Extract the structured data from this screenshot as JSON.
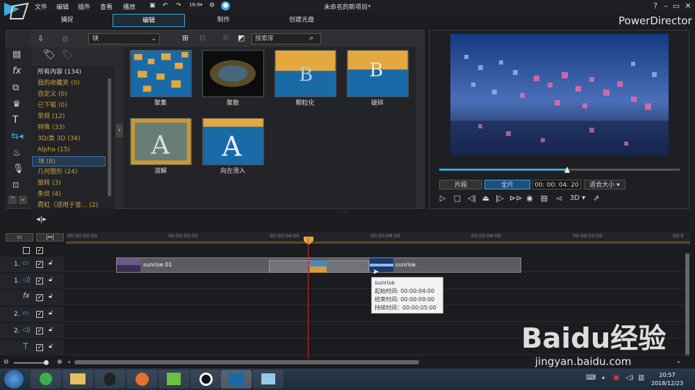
{
  "app": {
    "title": "未命名的新项目*",
    "brand": "PowerDirector"
  },
  "menu": [
    "文件",
    "编辑",
    "插件",
    "查看",
    "播放"
  ],
  "tabs": [
    "捕捉",
    "编辑",
    "制作",
    "创建光盘"
  ],
  "library": {
    "dropdown": "块",
    "search_placeholder": "搜索库",
    "categories": [
      "所有内容 (134)",
      "我的收藏夹 (0)",
      "自定义 (0)",
      "已下载 (0)",
      "常规 (12)",
      "特殊 (33)",
      "3D/类 3D (34)",
      "Alpha (15)",
      "块 (6)",
      "几何图形 (24)",
      "旋转 (3)",
      "条纹 (4)",
      "霓虹（适用于音... (2)"
    ],
    "thumbs": [
      "聚集",
      "聚散",
      "颗粒化",
      "破碎",
      "溶解",
      "向左滑入"
    ]
  },
  "preview": {
    "clip": "片段",
    "movie": "全片",
    "timecode": "00: 00: 04: 20",
    "fit": "适合大小",
    "mode3d": "3D",
    "progress": 0.53
  },
  "timeline": {
    "ticks": [
      "00:00:00:00",
      "00:00:02:00",
      "00:00:04:00",
      "00:00:06:00",
      "00:00:08:00",
      "00:00:10:00",
      "00:0"
    ],
    "tracks": [
      "1.",
      "1.",
      "",
      "2.",
      "2.",
      ""
    ],
    "clip1": "sunrise 01",
    "clip2": "sunrise",
    "tooltip": {
      "name": "sunrise",
      "start": "起始时间: 00:00:04:00",
      "end": "结束时间: 00:00:09:00",
      "dur": "持续时间：00:00:05:00"
    }
  },
  "taskbar": {
    "time": "20:57",
    "date": "2018/12/23"
  },
  "watermark": {
    "main": "Baidu经验",
    "sub": "jingyan.baidu.com"
  }
}
